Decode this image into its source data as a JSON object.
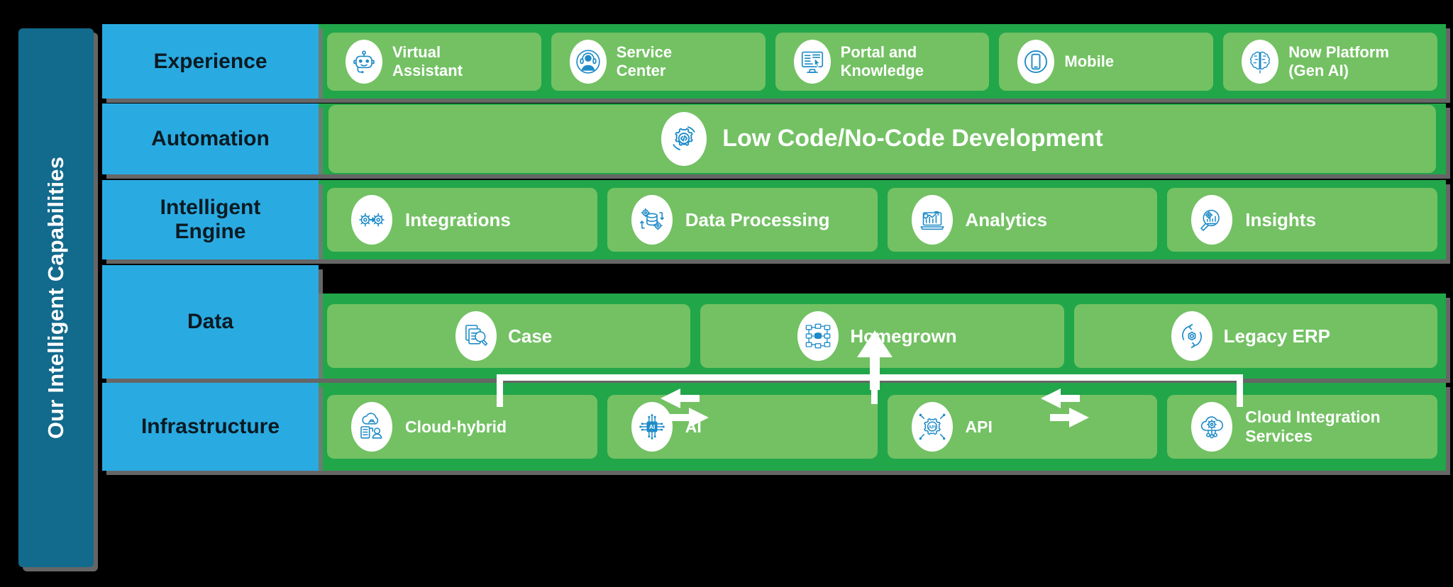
{
  "banner": {
    "title": "Our Intelligent Capabilities"
  },
  "colors": {
    "banner_bg": "#126A8C",
    "label_bg": "#29ABE2",
    "panel_bg": "#22A64A",
    "card_bg": "#73C163",
    "card_text": "#FFFFFF",
    "label_text": "#0B1A22",
    "icon_blue": "#1E8BC8",
    "page_bg": "#000000",
    "shadow": "#787878"
  },
  "rows": [
    {
      "id": "experience",
      "label": "Experience",
      "cards": [
        {
          "label": "Virtual\nAssistant",
          "icon": "robot-icon"
        },
        {
          "label": "Service\nCenter",
          "icon": "headset-agent-icon"
        },
        {
          "label": "Portal and\nKnowledge",
          "icon": "monitor-cursor-icon"
        },
        {
          "label": "Mobile",
          "icon": "smartphone-icon"
        },
        {
          "label": "Now Platform\n(Gen AI)",
          "icon": "brain-icon"
        }
      ]
    },
    {
      "id": "automation",
      "label": "Automation",
      "cards": [
        {
          "label": "Low Code/No-Code Development",
          "icon": "gear-code-icon"
        }
      ]
    },
    {
      "id": "engine",
      "label": "Intelligent\nEngine",
      "cards": [
        {
          "label": "Integrations",
          "icon": "gears-arrow-icon"
        },
        {
          "label": "Data Processing",
          "icon": "database-gears-icon"
        },
        {
          "label": "Analytics",
          "icon": "chart-laptop-icon"
        },
        {
          "label": "Insights",
          "icon": "magnifier-gear-icon"
        }
      ]
    },
    {
      "id": "data",
      "label": "Data",
      "cards": [
        {
          "label": "Case",
          "icon": "documents-search-icon"
        },
        {
          "label": "Homegrown",
          "icon": "network-nodes-icon"
        },
        {
          "label": "Legacy ERP",
          "icon": "sync-cycle-icon"
        }
      ],
      "connectors": {
        "bidirectional_arrows": 2,
        "bracket_to_engine": true,
        "up_arrow": true
      }
    },
    {
      "id": "infrastructure",
      "label": "Infrastructure",
      "cards": [
        {
          "label": "Cloud-hybrid",
          "icon": "cloud-server-user-icon"
        },
        {
          "label": "AI",
          "icon": "ai-chip-icon"
        },
        {
          "label": "API",
          "icon": "api-chip-icon"
        },
        {
          "label": "Cloud Integration\nServices",
          "icon": "cloud-gear-icon"
        }
      ]
    }
  ]
}
